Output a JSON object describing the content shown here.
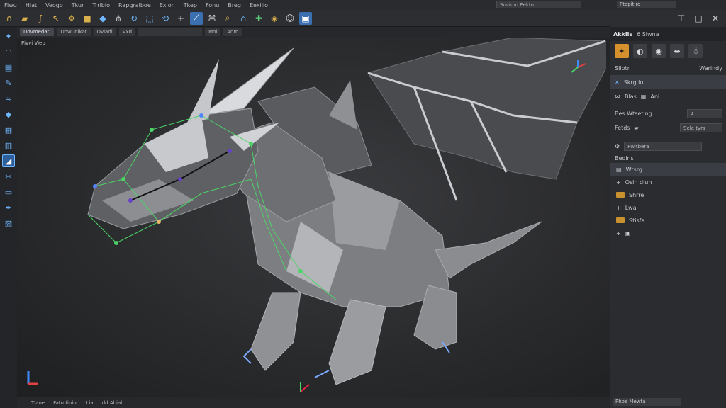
{
  "menubar": {
    "items": [
      "Fiwu",
      "Hlat",
      "Veogo",
      "Tkur",
      "Trriblo",
      "Rapgralboe",
      "Exlon",
      "Tkep",
      "Fonu",
      "Breg",
      "Eexilio"
    ],
    "search_value": "Sovimo Eekto",
    "right_field": "Ptopitiro"
  },
  "toolbar": {
    "icons": [
      "magnet-icon",
      "folder-open-icon",
      "curve-icon",
      "pointer-icon",
      "move-icon",
      "cube-icon",
      "diamond-icon",
      "snap-icon",
      "rotate-icon",
      "transform-icon",
      "refresh-icon",
      "add-icon",
      "bone-icon",
      "node-icon",
      "search-icon",
      "tree-icon",
      "arrow-move-icon",
      "warning-icon",
      "mask-icon",
      "window-icon"
    ],
    "right_icons": [
      "hammer-icon",
      "maximize-icon",
      "close-icon"
    ]
  },
  "viewport_tabs": [
    "Dovmedati",
    "Dowunikat",
    "Dviadi",
    "Vxd",
    "",
    "Moi",
    "Aqm"
  ],
  "viewport": {
    "label": "Pivvi Vieb"
  },
  "statusbar": {
    "items": [
      "Tlaoe",
      "Fatrofiniol",
      "Lia",
      "dd Abial"
    ]
  },
  "right_panel": {
    "tabs": [
      "Akkiis",
      "6 Slwna"
    ],
    "mode_label": "Silbtr",
    "mode_value": "Warindy",
    "tool_label": "Skrg lu",
    "subtools": [
      "Blas",
      "Ani"
    ],
    "field1_label": "Bes Wtseting",
    "field1_value": "4",
    "field2_label": "Fetds",
    "field2_value": "Sele tyrs",
    "dropdown_value": "Fwitbera",
    "section_label": "Beolns",
    "tree": [
      {
        "label": "Wtsrg",
        "type": "root"
      },
      {
        "label": "Osin diun",
        "type": "item"
      },
      {
        "label": "Shrre",
        "type": "folder"
      },
      {
        "label": "Lwa",
        "type": "item"
      },
      {
        "label": "Stisfa",
        "type": "folder"
      }
    ],
    "bottom_field": "Phoe Mewta"
  },
  "colors": {
    "accent": "#3c6fb0",
    "orange": "#d6902e",
    "bone_green": "#5cd37a"
  }
}
